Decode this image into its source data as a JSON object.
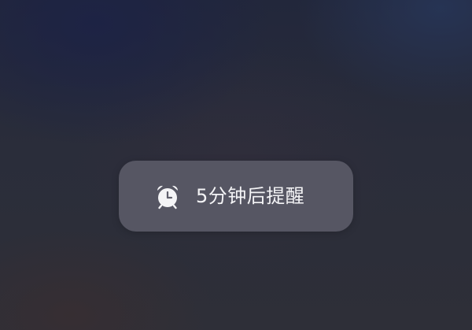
{
  "toast": {
    "icon": "alarm-clock-icon",
    "message": "5分钟后提醒"
  },
  "colors": {
    "toast_background": "#5f5f6c",
    "toast_text": "#f4f4f6",
    "wallpaper_top": "#22273b",
    "wallpaper_bottom": "#2e2f38"
  }
}
